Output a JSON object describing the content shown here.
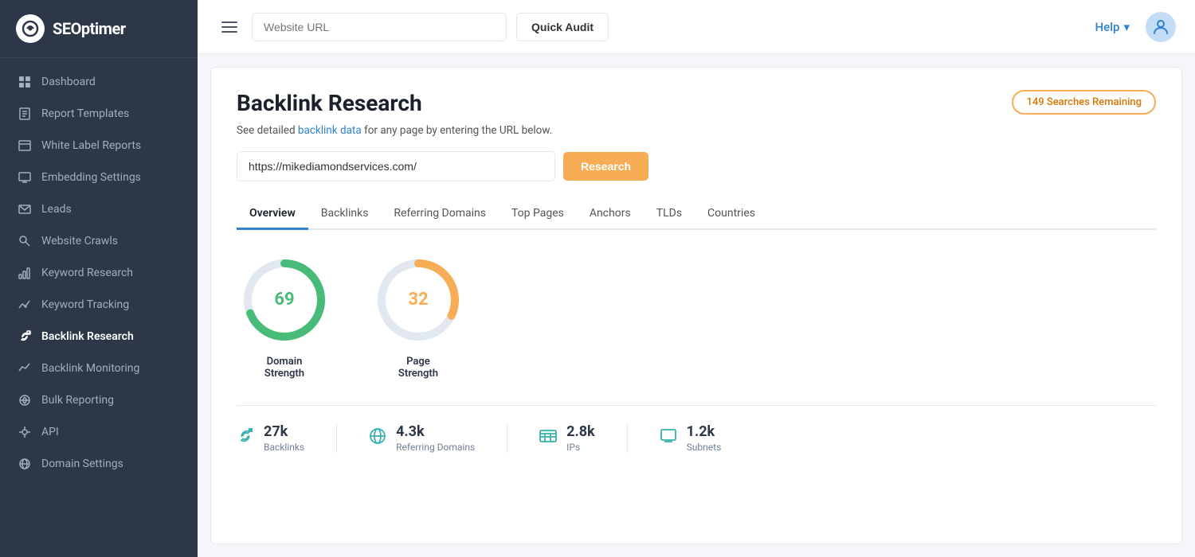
{
  "sidebar": {
    "logo_text": "SEOptimer",
    "nav_items": [
      {
        "id": "dashboard",
        "label": "Dashboard",
        "icon": "⊞"
      },
      {
        "id": "report-templates",
        "label": "Report Templates",
        "icon": "📄"
      },
      {
        "id": "white-label-reports",
        "label": "White Label Reports",
        "icon": "📋"
      },
      {
        "id": "embedding-settings",
        "label": "Embedding Settings",
        "icon": "🖥"
      },
      {
        "id": "leads",
        "label": "Leads",
        "icon": "✉"
      },
      {
        "id": "website-crawls",
        "label": "Website Crawls",
        "icon": "🔍"
      },
      {
        "id": "keyword-research",
        "label": "Keyword Research",
        "icon": "📊"
      },
      {
        "id": "keyword-tracking",
        "label": "Keyword Tracking",
        "icon": "📌"
      },
      {
        "id": "backlink-research",
        "label": "Backlink Research",
        "icon": "🔗",
        "active": true
      },
      {
        "id": "backlink-monitoring",
        "label": "Backlink Monitoring",
        "icon": "📈"
      },
      {
        "id": "bulk-reporting",
        "label": "Bulk Reporting",
        "icon": "☁"
      },
      {
        "id": "api",
        "label": "API",
        "icon": "⚙"
      },
      {
        "id": "domain-settings",
        "label": "Domain Settings",
        "icon": "🌐"
      }
    ]
  },
  "topbar": {
    "url_placeholder": "Website URL",
    "audit_button": "Quick Audit",
    "help_label": "Help",
    "help_dropdown": "▾"
  },
  "header": {
    "page_title": "Backlink Research",
    "description": "See detailed backlink data for any page by entering the URL below.",
    "description_link": "backlink data",
    "searches_badge": "149 Searches Remaining",
    "url_value": "https://mikediamondservices.com/",
    "research_button": "Research"
  },
  "tabs": [
    {
      "id": "overview",
      "label": "Overview",
      "active": true
    },
    {
      "id": "backlinks",
      "label": "Backlinks"
    },
    {
      "id": "referring-domains",
      "label": "Referring Domains"
    },
    {
      "id": "top-pages",
      "label": "Top Pages"
    },
    {
      "id": "anchors",
      "label": "Anchors"
    },
    {
      "id": "tlds",
      "label": "TLDs"
    },
    {
      "id": "countries",
      "label": "Countries"
    }
  ],
  "gauges": [
    {
      "id": "domain-strength",
      "value": 69,
      "label1": "Domain",
      "label2": "Strength",
      "color": "#48bb78",
      "track_color": "#e2e8f0",
      "percent": 69
    },
    {
      "id": "page-strength",
      "value": 32,
      "label1": "Page",
      "label2": "Strength",
      "color": "#f6ad55",
      "track_color": "#e2e8f0",
      "percent": 32
    }
  ],
  "stats": [
    {
      "id": "backlinks",
      "value": "27k",
      "label": "Backlinks",
      "icon": "🔗",
      "icon_color": "#38b2ac"
    },
    {
      "id": "referring-domains",
      "value": "4.3k",
      "label": "Referring Domains",
      "icon": "🌐",
      "icon_color": "#38b2ac"
    },
    {
      "id": "ips",
      "value": "2.8k",
      "label": "IPs",
      "icon": "📋",
      "icon_color": "#38b2ac"
    },
    {
      "id": "subnets",
      "value": "1.2k",
      "label": "Subnets",
      "icon": "🖥",
      "icon_color": "#38b2ac"
    }
  ]
}
